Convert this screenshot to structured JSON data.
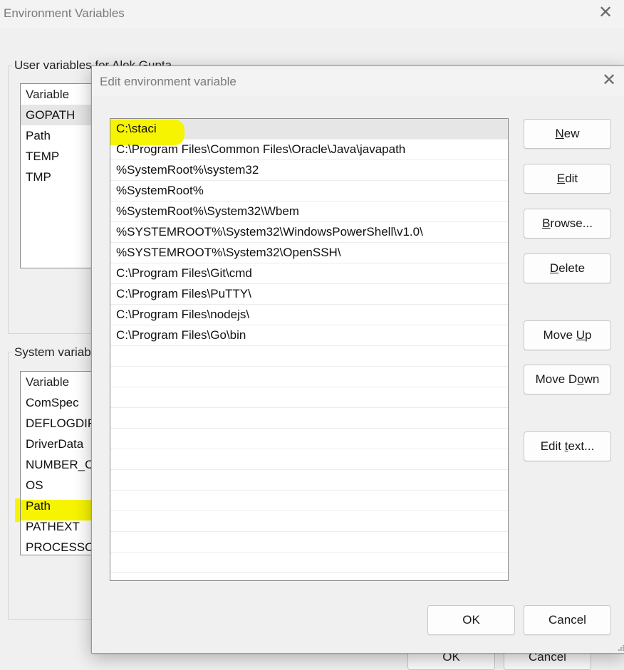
{
  "background_window": {
    "title": "Environment Variables",
    "close_glyph": "✕",
    "user_group_label": "User variables for Alok Gupta",
    "user_vars": {
      "header": "Variable",
      "rows": [
        "GOPATH",
        "Path",
        "TEMP",
        "TMP"
      ]
    },
    "system_group_label": "System variables",
    "system_vars": {
      "header": "Variable",
      "rows": [
        "ComSpec",
        "DEFLOGDIR",
        "DriverData",
        "NUMBER_OF_PROCESSORS",
        "OS",
        "Path",
        "PATHEXT",
        "PROCESSOR_ARCHITECTURE"
      ]
    },
    "ok_label": "OK",
    "cancel_label": "Cancel"
  },
  "dialog": {
    "title": "Edit environment variable",
    "close_glyph": "✕",
    "paths": [
      "C:\\staci",
      "C:\\Program Files\\Common Files\\Oracle\\Java\\javapath",
      "%SystemRoot%\\system32",
      "%SystemRoot%",
      "%SystemRoot%\\System32\\Wbem",
      "%SYSTEMROOT%\\System32\\WindowsPowerShell\\v1.0\\",
      "%SYSTEMROOT%\\System32\\OpenSSH\\",
      "C:\\Program Files\\Git\\cmd",
      "C:\\Program Files\\PuTTY\\",
      "C:\\Program Files\\nodejs\\",
      "C:\\Program Files\\Go\\bin"
    ],
    "empty_rows": 11,
    "buttons": {
      "new": {
        "pre": "",
        "key": "N",
        "post": "ew"
      },
      "edit": {
        "pre": "",
        "key": "E",
        "post": "dit"
      },
      "browse": {
        "pre": "",
        "key": "B",
        "post": "rowse..."
      },
      "delete": {
        "pre": "",
        "key": "D",
        "post": "elete"
      },
      "move_up": {
        "pre": "Move ",
        "key": "U",
        "post": "p"
      },
      "move_down": {
        "pre": "Move D",
        "key": "o",
        "post": "wn"
      },
      "edit_text": {
        "pre": "Edit ",
        "key": "t",
        "post": "ext..."
      },
      "ok": "OK",
      "cancel": "Cancel"
    }
  },
  "colors": {
    "highlight": "#f6f400",
    "selection": "#e6e6e6",
    "window_bg": "#f0f0f0"
  },
  "icons": {
    "close": "close-icon",
    "resize": "resize-grip-icon"
  }
}
